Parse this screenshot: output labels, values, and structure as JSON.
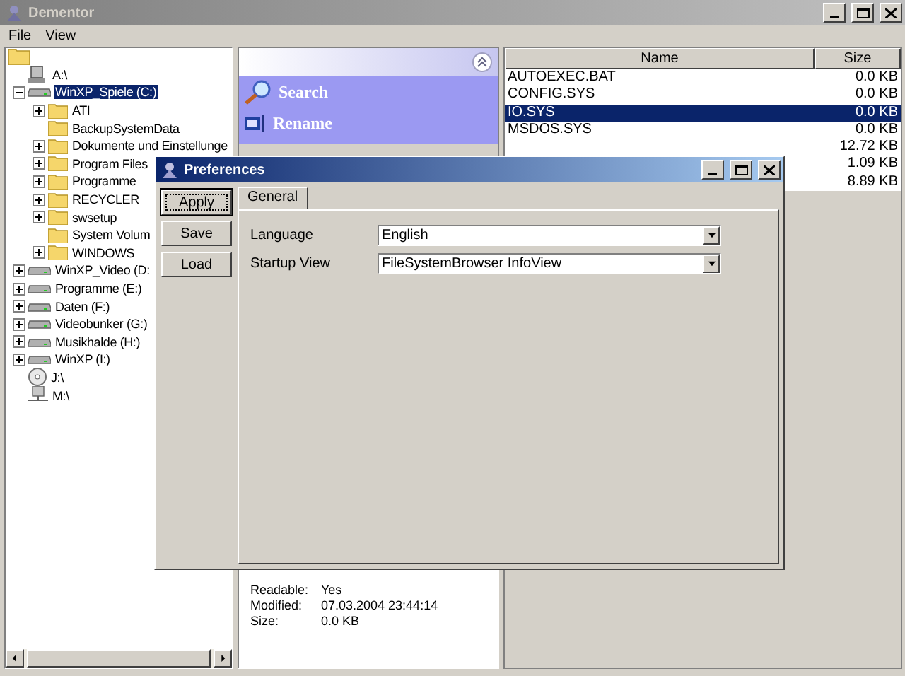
{
  "window": {
    "title": "Dementor"
  },
  "menu": [
    "File",
    "View"
  ],
  "tree": {
    "children": [
      {
        "label": "A:\\",
        "kind": "floppy",
        "selected": false
      },
      {
        "label": "WinXP_Spiele (C:)",
        "kind": "drive",
        "expanded": true,
        "selected": true,
        "children": [
          {
            "label": "ATI",
            "kind": "folder",
            "expanded": false,
            "selected": false
          },
          {
            "label": "BackupSystemData",
            "kind": "folder",
            "selected": false
          },
          {
            "label": "Dokumente und Einstellunge",
            "kind": "folder",
            "expanded": false,
            "selected": false
          },
          {
            "label": "Program Files",
            "kind": "folder",
            "expanded": false,
            "selected": false
          },
          {
            "label": "Programme",
            "kind": "folder",
            "expanded": false,
            "selected": false
          },
          {
            "label": "RECYCLER",
            "kind": "folder",
            "expanded": false,
            "selected": false
          },
          {
            "label": "swsetup",
            "kind": "folder",
            "expanded": false,
            "selected": false
          },
          {
            "label": "System Volum",
            "kind": "folder",
            "selected": false
          },
          {
            "label": "WINDOWS",
            "kind": "folder",
            "expanded": false,
            "selected": false
          }
        ]
      },
      {
        "label": "WinXP_Video (D:",
        "kind": "drive",
        "expanded": false,
        "selected": false
      },
      {
        "label": "Programme (E:)",
        "kind": "drive",
        "expanded": false,
        "selected": false
      },
      {
        "label": "Daten (F:)",
        "kind": "drive",
        "expanded": false,
        "selected": false
      },
      {
        "label": "Videobunker (G:)",
        "kind": "drive",
        "expanded": false,
        "selected": false
      },
      {
        "label": "Musikhalde (H:)",
        "kind": "drive",
        "expanded": false,
        "selected": false
      },
      {
        "label": "WinXP (I:)",
        "kind": "drive",
        "expanded": false,
        "selected": false
      },
      {
        "label": "J:\\",
        "kind": "cd",
        "selected": false
      },
      {
        "label": "M:\\",
        "kind": "net",
        "selected": false
      }
    ]
  },
  "tasks": [
    {
      "label": "Search",
      "kind": "search"
    },
    {
      "label": "Rename",
      "kind": "rename"
    }
  ],
  "info": [
    {
      "label": "Readable:",
      "value": "Yes"
    },
    {
      "label": "Modified:",
      "value": "07.03.2004 23:44:14"
    },
    {
      "label": "Size:",
      "value": "0.0 KB"
    }
  ],
  "files": {
    "columns": [
      "Name",
      "Size"
    ],
    "rows": [
      {
        "name": "AUTOEXEC.BAT",
        "size": "0.0 KB",
        "selected": false
      },
      {
        "name": "CONFIG.SYS",
        "size": "0.0 KB",
        "selected": false
      },
      {
        "name": "IO.SYS",
        "size": "0.0 KB",
        "selected": true
      },
      {
        "name": "MSDOS.SYS",
        "size": "0.0 KB",
        "selected": false
      },
      {
        "size": "12.72 KB",
        "selected": false
      },
      {
        "size": "1.09 KB",
        "selected": false
      },
      {
        "size": "8.89 KB",
        "selected": false
      }
    ]
  },
  "dialog": {
    "title": "Preferences",
    "buttons": [
      {
        "label": "Apply",
        "focused": true
      },
      {
        "label": "Save",
        "focused": false
      },
      {
        "label": "Load",
        "focused": false
      }
    ],
    "tabs": [
      {
        "label": "General",
        "selected": true
      }
    ],
    "fields": [
      {
        "label": "Language",
        "value": "English"
      },
      {
        "label": "Startup View",
        "value": "FileSystemBrowser InfoView"
      }
    ]
  }
}
